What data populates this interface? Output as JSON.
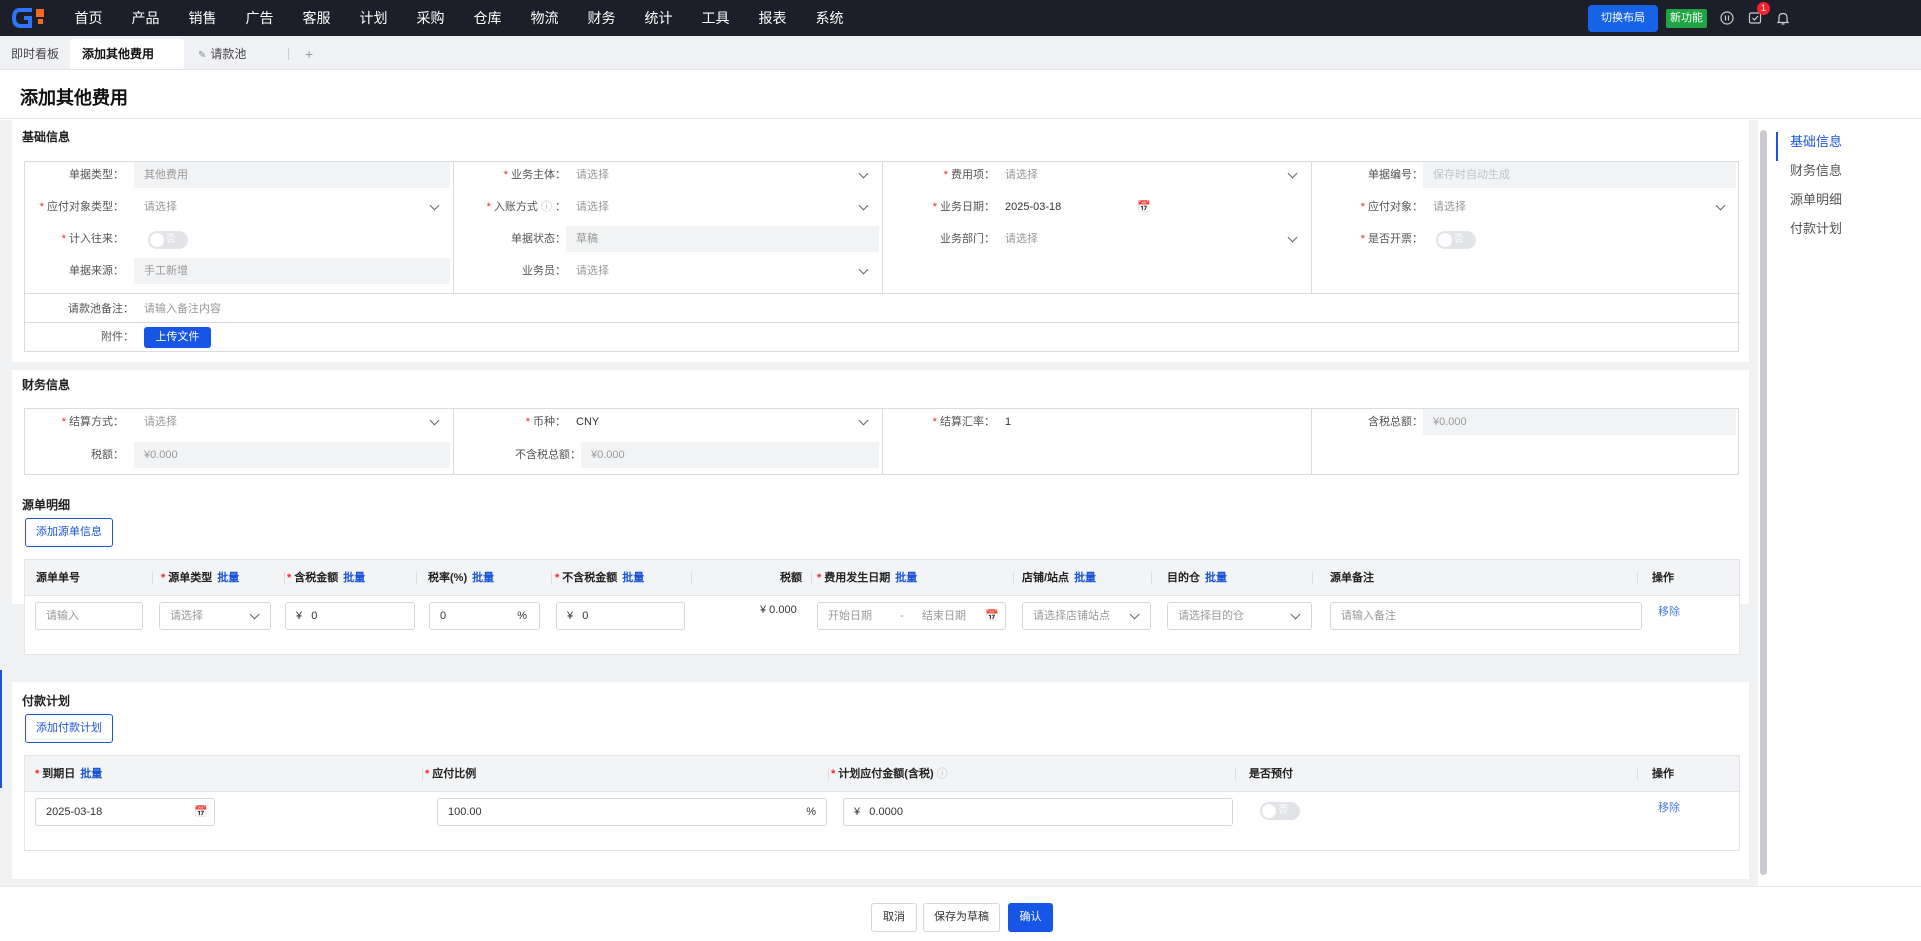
{
  "nav": {
    "menu": [
      "首页",
      "产品",
      "销售",
      "广告",
      "客服",
      "计划",
      "采购",
      "仓库",
      "物流",
      "财务",
      "统计",
      "工具",
      "报表",
      "系统"
    ],
    "switch_layout": "切换布局",
    "new_feature": "新功能",
    "notify_count": "1"
  },
  "tabs": {
    "dashboard": "即时看板",
    "current": "添加其他费用",
    "pool": "请款池",
    "plus": "+"
  },
  "page": {
    "title": "添加其他费用"
  },
  "basic": {
    "title": "基础信息",
    "doc_type_label": "单据类型：",
    "doc_type_value": "其他费用",
    "payee_type_label": "应付对象类型：",
    "payee_type_ph": "请选择",
    "count_label": "计入往来：",
    "count_value": "否",
    "source_label": "单据来源：",
    "source_value": "手工新增",
    "entity_label": "业务主体：",
    "entity_ph": "请选择",
    "entry_label": "入账方式",
    "entry_ph": "请选择",
    "status_label": "单据状态：",
    "status_value": "草稿",
    "salesman_label": "业务员：",
    "salesman_ph": "请选择",
    "fee_item_label": "费用项：",
    "fee_item_ph": "请选择",
    "biz_date_label": "业务日期：",
    "biz_date_value": "2025-03-18",
    "dept_label": "业务部门：",
    "dept_ph": "请选择",
    "doc_no_label": "单据编号：",
    "doc_no_ph": "保存时自动生成",
    "payee_label": "应付对象：",
    "payee_ph": "请选择",
    "invoice_label": "是否开票：",
    "invoice_value": "否",
    "remark_label": "请款池备注：",
    "remark_ph": "请输入备注内容",
    "attach_label": "附件：",
    "upload": "上传文件"
  },
  "finance": {
    "title": "财务信息",
    "settle_label": "结算方式：",
    "settle_ph": "请选择",
    "tax_label": "税额：",
    "tax_value": "¥0.000",
    "currency_label": "币种：",
    "currency_value": "CNY",
    "untaxed_label": "不含税总额：",
    "untaxed_value": "¥0.000",
    "rate_label": "结算汇率：",
    "rate_value": "1",
    "taxed_total_label": "含税总额：",
    "taxed_total_value": "¥0.000"
  },
  "source": {
    "title": "源单明细",
    "add_btn": "添加源单信息",
    "batch": "批量",
    "headers": {
      "no": "源单单号",
      "type": "源单类型",
      "taxed": "含税金额",
      "rate": "税率(%)",
      "untaxed": "不含税金额",
      "tax": "税额",
      "date": "费用发生日期",
      "shop": "店铺/站点",
      "wh": "目的仓",
      "remark": "源单备注",
      "op": "操作"
    },
    "row": {
      "no_ph": "请输入",
      "type_ph": "请选择",
      "yen": "¥",
      "taxed": "0",
      "rate": "0",
      "pct": "%",
      "untaxed": "0",
      "tax": "¥ 0.000",
      "start_ph": "开始日期",
      "dash": "-",
      "end_ph": "结束日期",
      "shop_ph": "请选择店铺站点",
      "wh_ph": "请选择目的仓",
      "remark_ph": "请输入备注",
      "remove": "移除"
    }
  },
  "plan": {
    "title": "付款计划",
    "add_btn": "添加付款计划",
    "batch": "批量",
    "headers": {
      "due": "到期日",
      "ratio": "应付比例",
      "amount": "计划应付金额(含税)",
      "prepay": "是否预付",
      "op": "操作"
    },
    "row": {
      "due": "2025-03-18",
      "ratio": "100.00",
      "pct": "%",
      "yen": "¥",
      "amount": "0.0000",
      "prepay": "否",
      "remove": "移除"
    }
  },
  "rightnav": [
    "基础信息",
    "财务信息",
    "源单明细",
    "付款计划"
  ],
  "footer": {
    "cancel": "取消",
    "draft": "保存为草稿",
    "confirm": "确认"
  }
}
